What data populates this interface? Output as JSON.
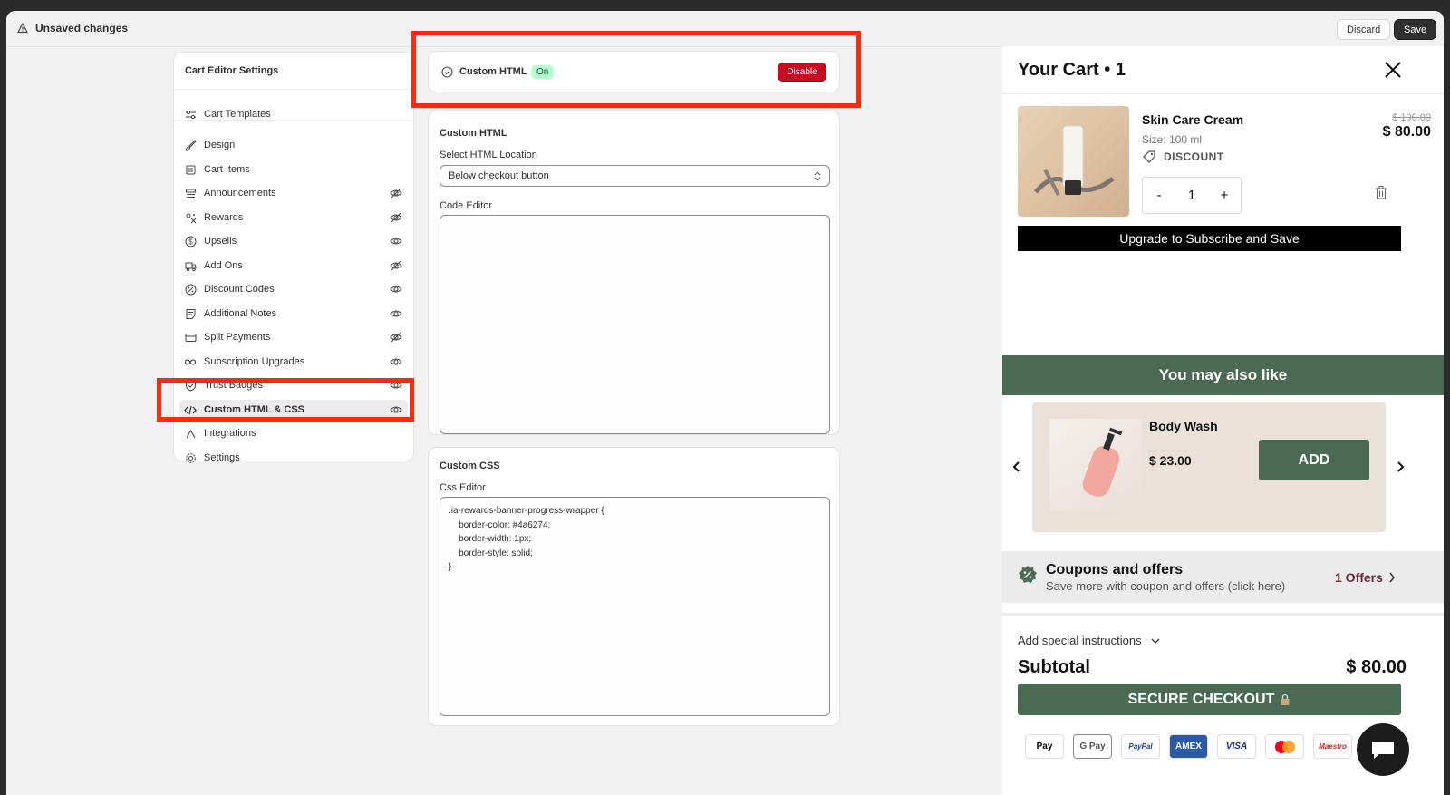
{
  "topbar": {
    "unsaved_label": "Unsaved changes",
    "discard_label": "Discard",
    "save_label": "Save"
  },
  "sidebar": {
    "title": "Cart Editor Settings",
    "items": [
      {
        "label": "Cart Templates",
        "icon": "sliders-icon",
        "visibility": "none"
      },
      {
        "label": "Design",
        "icon": "brush-icon",
        "visibility": "none"
      },
      {
        "label": "Cart Items",
        "icon": "cart-icon",
        "visibility": "none"
      },
      {
        "label": "Announcements",
        "icon": "announcement-icon",
        "visibility": "hidden"
      },
      {
        "label": "Rewards",
        "icon": "rewards-icon",
        "visibility": "hidden"
      },
      {
        "label": "Upsells",
        "icon": "dollar-circle-icon",
        "visibility": "visible"
      },
      {
        "label": "Add Ons",
        "icon": "truck-icon",
        "visibility": "hidden"
      },
      {
        "label": "Discount Codes",
        "icon": "discount-icon",
        "visibility": "visible"
      },
      {
        "label": "Additional Notes",
        "icon": "note-icon",
        "visibility": "visible"
      },
      {
        "label": "Split Payments",
        "icon": "card-icon",
        "visibility": "hidden"
      },
      {
        "label": "Subscription Upgrades",
        "icon": "infinity-icon",
        "visibility": "visible"
      },
      {
        "label": "Trust Badges",
        "icon": "shield-check-icon",
        "visibility": "visible"
      },
      {
        "label": "Custom HTML & CSS",
        "icon": "code-icon",
        "visibility": "visible",
        "active": true
      },
      {
        "label": "Integrations",
        "icon": "integration-icon",
        "visibility": "none"
      },
      {
        "label": "Settings",
        "icon": "gear-icon",
        "visibility": "none"
      }
    ]
  },
  "status": {
    "label": "Custom HTML",
    "badge": "On",
    "disable_label": "Disable"
  },
  "custom_html": {
    "title": "Custom HTML",
    "location_label": "Select HTML Location",
    "location_value": "Below checkout button",
    "editor_label": "Code Editor",
    "editor_value": ""
  },
  "custom_css": {
    "title": "Custom CSS",
    "editor_label": "Css Editor",
    "editor_value": ".ia-rewards-banner-progress-wrapper {\n    border-color: #4a6274;\n    border-width: 1px;\n    border-style: solid;\n}"
  },
  "cart": {
    "title": "Your Cart • 1",
    "item": {
      "name": "Skin Care Cream",
      "size": "Size: 100 ml",
      "discount_label": "DISCOUNT",
      "price_old": "$ 100.00",
      "price_new": "$ 80.00",
      "qty_minus": "-",
      "qty": "1",
      "qty_plus": "+"
    },
    "upgrade_label": "Upgrade to Subscribe and Save",
    "also_like_title": "You may also like",
    "upsell": {
      "name": "Body Wash",
      "price": "$ 23.00",
      "add_label": "ADD"
    },
    "coupon": {
      "title": "Coupons and offers",
      "subtitle": "Save more with coupon and offers (click here)",
      "offers": "1 Offers"
    },
    "instructions_label": "Add special instructions",
    "subtotal_label": "Subtotal",
    "subtotal_value": "$ 80.00",
    "checkout_label": "SECURE CHECKOUT",
    "payment_methods": [
      "Pay",
      "G Pay",
      "PayPal",
      "AMEX",
      "VISA",
      "mastercard",
      "Maestro"
    ]
  },
  "colors": {
    "accent_green": "#4a6a54",
    "danger": "#c70a24",
    "highlight": "#ff2a10"
  }
}
